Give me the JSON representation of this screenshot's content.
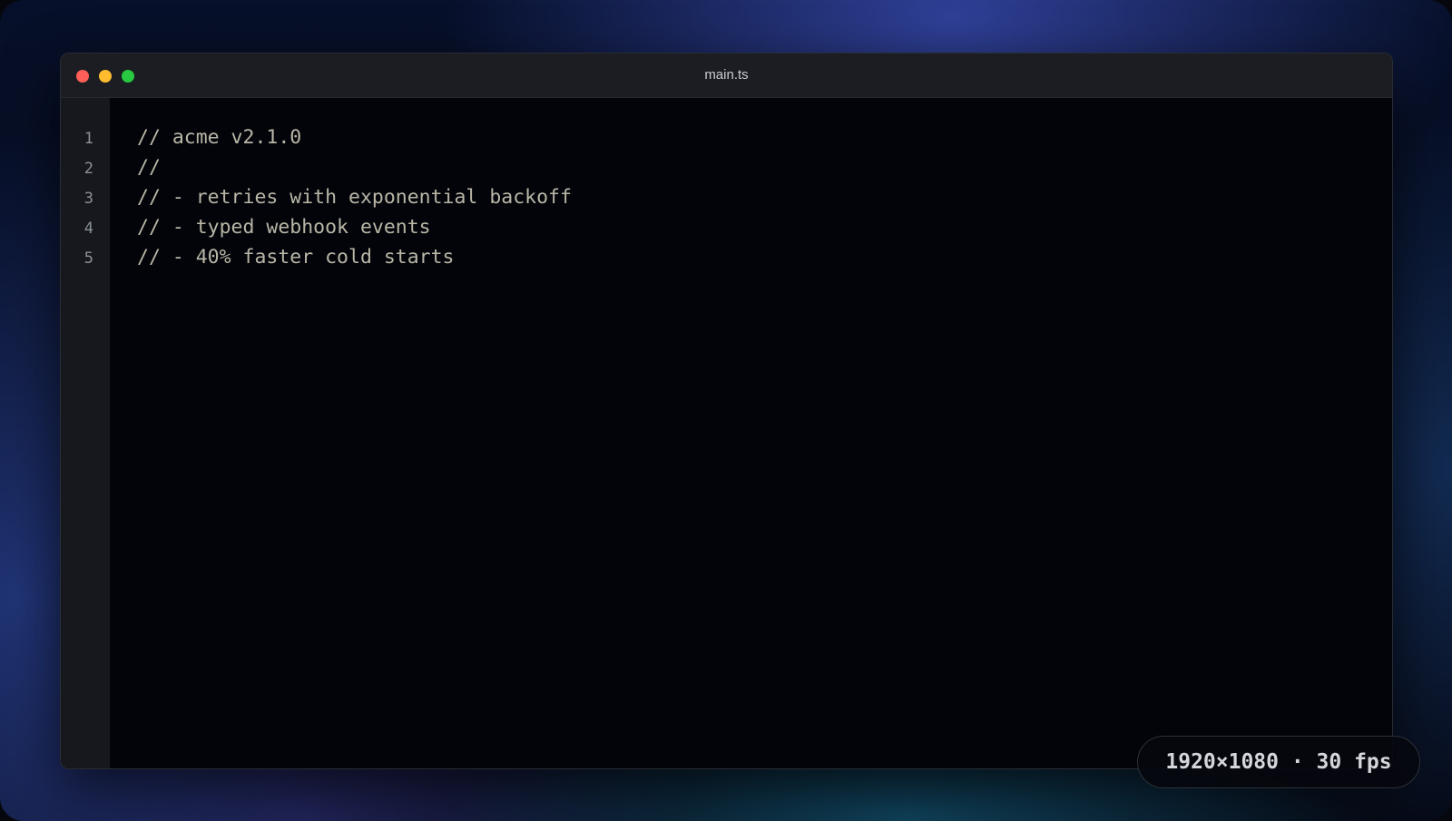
{
  "window": {
    "title": "main.ts",
    "controls": {
      "close_color": "#ff5f57",
      "minimize_color": "#febc2e",
      "maximize_color": "#28c840"
    }
  },
  "editor": {
    "lines": [
      {
        "number": "1",
        "text": "// acme v2.1.0"
      },
      {
        "number": "2",
        "text": "//"
      },
      {
        "number": "3",
        "text": "// - retries with exponential backoff"
      },
      {
        "number": "4",
        "text": "// - typed webhook events"
      },
      {
        "number": "5",
        "text": "// - 40% faster cold starts"
      }
    ],
    "comment_color": "#b9b6a6"
  },
  "badge": {
    "text": "1920×1080 · 30 fps"
  }
}
